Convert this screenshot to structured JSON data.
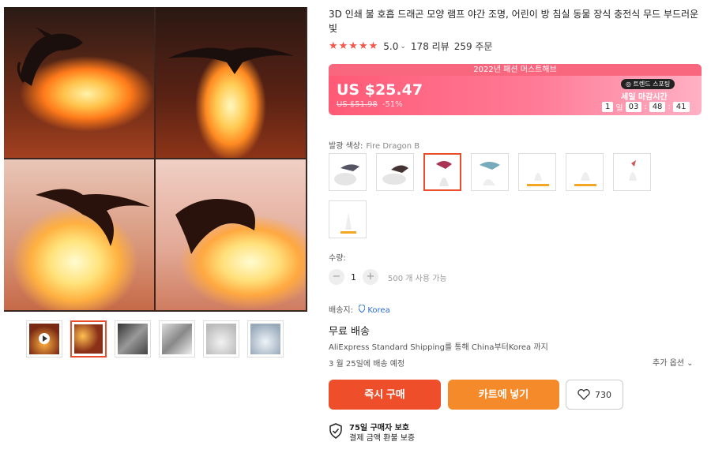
{
  "product": {
    "title": "3D 인쇄 불 호흡 드래곤 모양 램프 야간 조명, 어린이 방 침실 동물 장식 충전식 무드 부드러운 빛",
    "rating": "5.0",
    "rating_caret": "⌄",
    "reviews": "178 리뷰",
    "orders": "259 주문"
  },
  "promo": {
    "banner": "2022년 패션 머스트해브",
    "price": "US $25.47",
    "old_price": "US $51.98",
    "discount": "-51%",
    "trend_badge": "◎ 트렌드 스포팅",
    "deal_label": "세일 마감시간",
    "countdown": {
      "days": "1",
      "days_label": "일",
      "hours": "03",
      "minutes": "48",
      "seconds": "41"
    }
  },
  "variants": {
    "label": "발광 색상:",
    "selected": "Fire Dragon B"
  },
  "quantity": {
    "label": "수량:",
    "value": "1",
    "minus": "−",
    "plus": "+",
    "note": "500 개 사용 가능"
  },
  "shipping": {
    "to_label": "배송지:",
    "to_value": "Korea",
    "free": "무료 배송",
    "desc": "AliExpress Standard Shipping를 통해 China부터Korea 까지",
    "eta": "3 월 25일에 배송 예정",
    "more": "추가 옵션 ⌄"
  },
  "actions": {
    "buy": "즉시 구매",
    "cart": "카트에 넣기",
    "wish_count": "730"
  },
  "protection": {
    "title": "75일 구매자 보호",
    "desc": "결제 금액 환불 보증"
  },
  "colors": {
    "accent": "#ee4e2a",
    "cart": "#f48a2a",
    "promo": "#ff5a76",
    "link": "#2a6fcf"
  }
}
